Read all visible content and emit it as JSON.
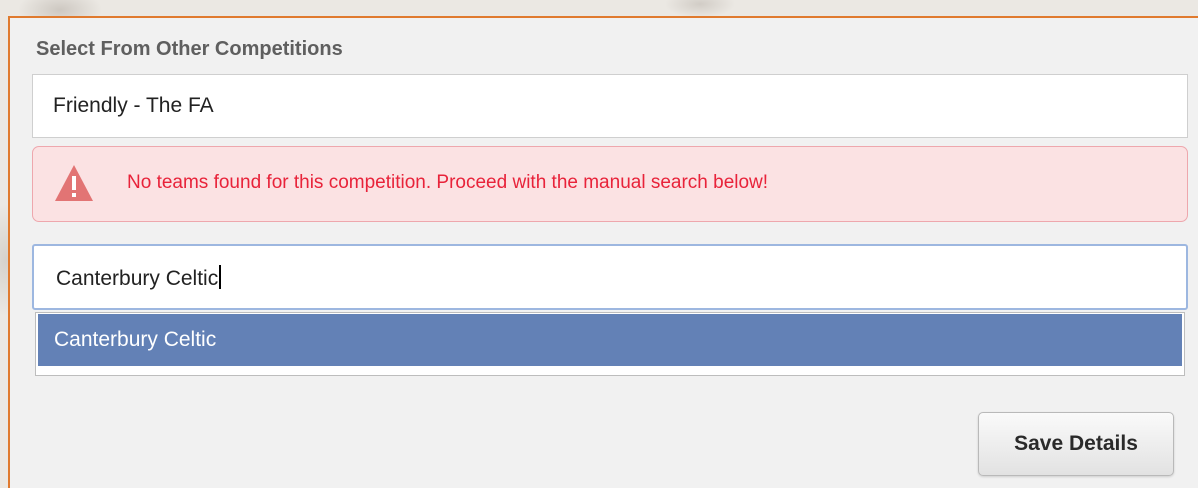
{
  "form": {
    "section_label": "Select From Other Competitions",
    "competition_value": "Friendly - The FA",
    "alert": {
      "icon": "warning-triangle-icon",
      "message": "No teams found for this competition. Proceed with the manual search below!"
    },
    "search": {
      "value": "Canterbury Celtic"
    },
    "suggestions": [
      {
        "label": "Canterbury Celtic",
        "highlighted": true
      }
    ],
    "save_label": "Save Details"
  },
  "colors": {
    "panel_border": "#e07a2e",
    "alert_text": "#e8233a",
    "alert_bg": "#fbe2e3",
    "highlight": "#6381b6"
  }
}
